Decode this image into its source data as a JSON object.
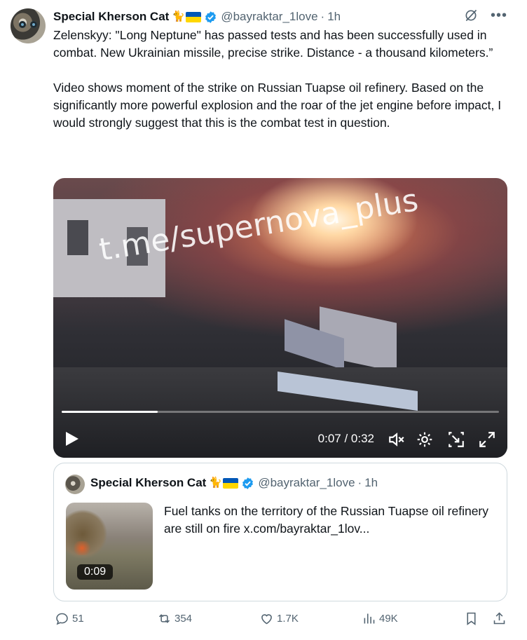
{
  "author": {
    "name": "Special Kherson Cat",
    "handle": "@bayraktar_1love",
    "time": "1h"
  },
  "tweet": {
    "text": "Zelenskyy: \"Long Neptune\" has passed tests and has been successfully used in combat. New Ukrainian missile, precise strike. Distance - a thousand kilometers.”\n\nVideo shows moment of the strike on Russian Tuapse oil refinery. Based on the significantly more powerful explosion and the roar of the jet engine before impact, I would strongly suggest that this is the combat test in question."
  },
  "video": {
    "watermark": "t.me/supernova_plus",
    "time_display": "0:07 / 0:32",
    "progress": 0.22
  },
  "quote": {
    "name": "Special Kherson Cat",
    "handle": "@bayraktar_1love",
    "time": "1h",
    "text": "Fuel tanks on the territory of the Russian Tuapse oil refinery are still on fire  x.com/bayraktar_1lov...",
    "duration": "0:09"
  },
  "actions": {
    "replies": "51",
    "reposts": "354",
    "likes": "1.7K",
    "views": "49K"
  },
  "colors": {
    "text": "#0f1419",
    "secondary": "#536471",
    "verified": "#1d9bf0",
    "border": "#cfd9de"
  }
}
